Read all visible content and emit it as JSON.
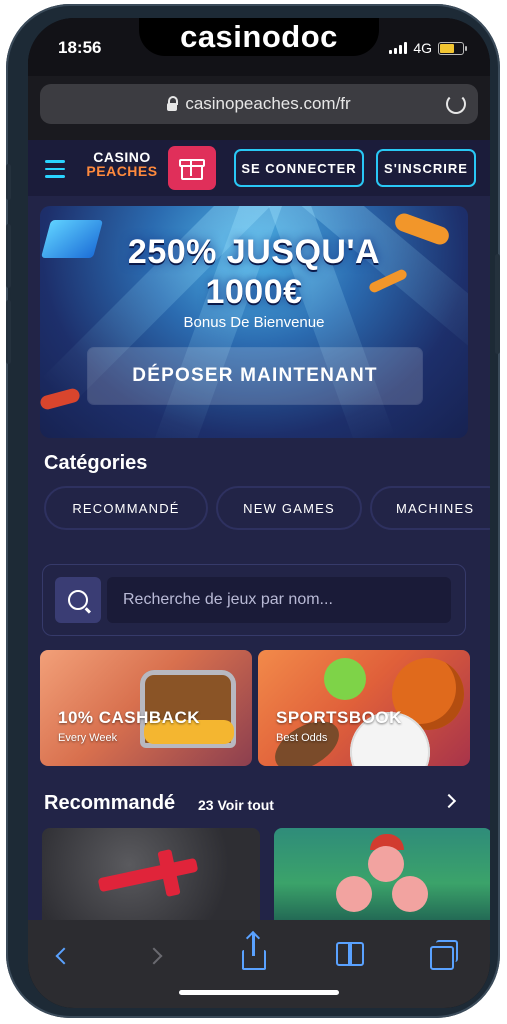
{
  "status_bar": {
    "time": "18:56",
    "network": "4G",
    "brand_text": "casinodoc"
  },
  "browser": {
    "url": "casinopeaches.com/fr"
  },
  "site_header": {
    "logo_line1": "CASINO",
    "logo_line2": "PEACHES",
    "login_label": "SE CONNECTER",
    "signup_label": "S'INSCRIRE"
  },
  "promo": {
    "title_line1": "250% JUSQU'A",
    "title_line2": "1000€",
    "subtitle": "Bonus De Bienvenue",
    "cta": "DÉPOSER MAINTENANT"
  },
  "categories": {
    "title": "Catégories",
    "items": [
      "RECOMMANDÉ",
      "NEW GAMES",
      "MACHINES"
    ]
  },
  "search": {
    "placeholder": "Recherche de jeux par nom..."
  },
  "cards": [
    {
      "title": "10% CASHBACK",
      "subtitle": "Every Week"
    },
    {
      "title": "SPORTSBOOK",
      "subtitle": "Best Odds"
    }
  ],
  "recommended": {
    "title": "Recommandé",
    "count_link": "23 Voir tout"
  },
  "colors": {
    "accent": "#29c8f5",
    "background": "#222447",
    "gift": "#e02f5a"
  }
}
